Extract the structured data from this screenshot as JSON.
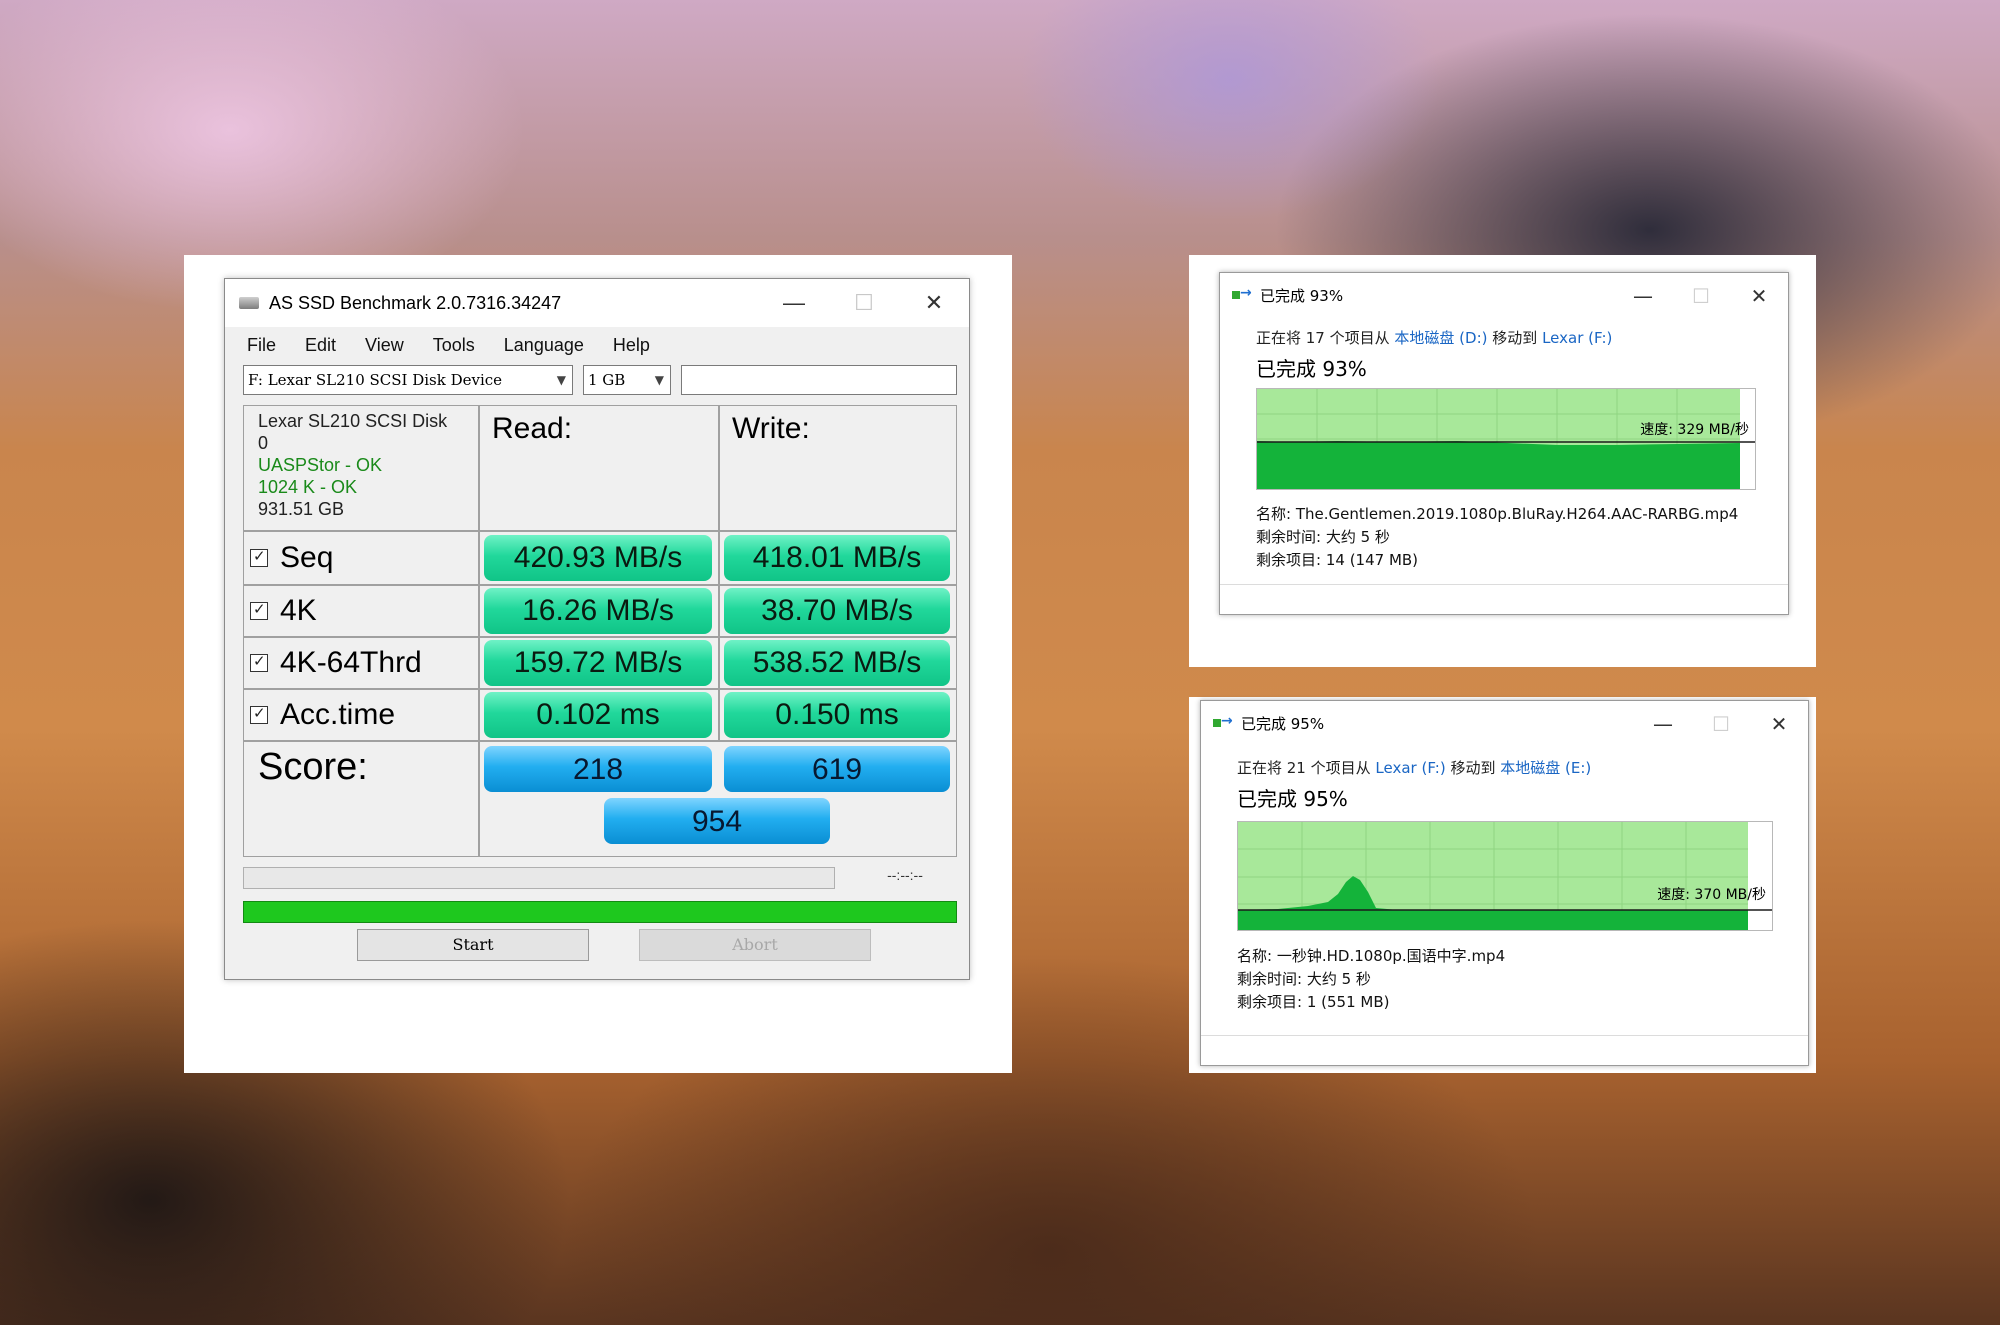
{
  "as_ssd": {
    "title": "AS SSD Benchmark 2.0.7316.34247",
    "menu": [
      "File",
      "Edit",
      "View",
      "Tools",
      "Language",
      "Help"
    ],
    "drive_select": "F: Lexar SL210 SCSI Disk Device",
    "size_select": "1 GB",
    "device_info": {
      "name": "Lexar SL210 SCSI Disk",
      "index": "0",
      "driver": "UASPStor - OK",
      "align": "1024 K - OK",
      "capacity": "931.51 GB"
    },
    "read_header": "Read:",
    "write_header": "Write:",
    "rows": [
      {
        "label": "Seq",
        "read": "420.93 MB/s",
        "write": "418.01 MB/s"
      },
      {
        "label": "4K",
        "read": "16.26 MB/s",
        "write": "38.70 MB/s"
      },
      {
        "label": "4K-64Thrd",
        "read": "159.72 MB/s",
        "write": "538.52 MB/s"
      },
      {
        "label": "Acc.time",
        "read": "0.102 ms",
        "write": "0.150 ms"
      }
    ],
    "score_label": "Score:",
    "score_read": "218",
    "score_write": "619",
    "score_total": "954",
    "timer": "--:--:--",
    "start_label": "Start",
    "abort_label": "Abort"
  },
  "copy_top": {
    "title": "已完成 93%",
    "line_prefix": "正在将 17 个项目从",
    "source": "本地磁盘 (D:)",
    "line_mid": "移动到",
    "dest": "Lexar (F:)",
    "status": "已完成 93%",
    "speed": "速度: 329 MB/秒",
    "name_label": "名称:",
    "name_value": "The.Gentlemen.2019.1080p.BluRay.H264.AAC-RARBG.mp4",
    "time_label": "剩余时间:",
    "time_value": "大约 5 秒",
    "items_label": "剩余项目:",
    "items_value": "14 (147 MB)",
    "progress": 0.93
  },
  "copy_bottom": {
    "title": "已完成 95%",
    "line_prefix": "正在将 21 个项目从",
    "source": "Lexar (F:)",
    "line_mid": "移动到",
    "dest": "本地磁盘 (E:)",
    "status": "已完成 95%",
    "speed": "速度: 370 MB/秒",
    "name_label": "名称:",
    "name_value": "一秒钟.HD.1080p.国语中字.mp4",
    "time_label": "剩余时间:",
    "time_value": "大约 5 秒",
    "items_label": "剩余项目:",
    "items_value": "1 (551 MB)",
    "progress": 0.95
  },
  "window_controls": {
    "minimize": "—",
    "maximize": "☐",
    "close": "✕"
  },
  "colors": {
    "result_green": "#21d89b",
    "score_blue": "#22aef0",
    "progress_green": "#1ec81e",
    "graph_fill": "#14b33a",
    "graph_bg": "#a8e89a",
    "link_blue": "#1a66c4"
  }
}
